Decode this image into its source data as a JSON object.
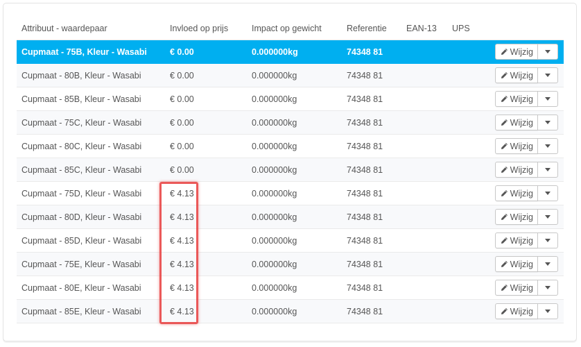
{
  "table": {
    "headers": [
      "Attribuut - waardepaar",
      "Invloed op prijs",
      "Impact op gewicht",
      "Referentie",
      "EAN-13",
      "UPS"
    ],
    "rows": [
      {
        "attributes": "Cupmaat - 75B, Kleur - Wasabi",
        "price_impact": "€ 0.00",
        "weight_impact": "0.000000kg",
        "reference": "74348 81",
        "ean13": "",
        "ups": "",
        "selected": true
      },
      {
        "attributes": "Cupmaat - 80B, Kleur - Wasabi",
        "price_impact": "€ 0.00",
        "weight_impact": "0.000000kg",
        "reference": "74348 81",
        "ean13": "",
        "ups": ""
      },
      {
        "attributes": "Cupmaat - 85B, Kleur - Wasabi",
        "price_impact": "€ 0.00",
        "weight_impact": "0.000000kg",
        "reference": "74348 81",
        "ean13": "",
        "ups": ""
      },
      {
        "attributes": "Cupmaat - 75C, Kleur - Wasabi",
        "price_impact": "€ 0.00",
        "weight_impact": "0.000000kg",
        "reference": "74348 81",
        "ean13": "",
        "ups": ""
      },
      {
        "attributes": "Cupmaat - 80C, Kleur - Wasabi",
        "price_impact": "€ 0.00",
        "weight_impact": "0.000000kg",
        "reference": "74348 81",
        "ean13": "",
        "ups": ""
      },
      {
        "attributes": "Cupmaat - 85C, Kleur - Wasabi",
        "price_impact": "€ 0.00",
        "weight_impact": "0.000000kg",
        "reference": "74348 81",
        "ean13": "",
        "ups": ""
      },
      {
        "attributes": "Cupmaat - 75D, Kleur - Wasabi",
        "price_impact": "€ 4.13",
        "weight_impact": "0.000000kg",
        "reference": "74348 81",
        "ean13": "",
        "ups": ""
      },
      {
        "attributes": "Cupmaat - 80D, Kleur - Wasabi",
        "price_impact": "€ 4.13",
        "weight_impact": "0.000000kg",
        "reference": "74348 81",
        "ean13": "",
        "ups": ""
      },
      {
        "attributes": "Cupmaat - 85D, Kleur - Wasabi",
        "price_impact": "€ 4.13",
        "weight_impact": "0.000000kg",
        "reference": "74348 81",
        "ean13": "",
        "ups": ""
      },
      {
        "attributes": "Cupmaat - 75E, Kleur - Wasabi",
        "price_impact": "€ 4.13",
        "weight_impact": "0.000000kg",
        "reference": "74348 81",
        "ean13": "",
        "ups": ""
      },
      {
        "attributes": "Cupmaat - 80E, Kleur - Wasabi",
        "price_impact": "€ 4.13",
        "weight_impact": "0.000000kg",
        "reference": "74348 81",
        "ean13": "",
        "ups": ""
      },
      {
        "attributes": "Cupmaat - 85E, Kleur - Wasabi",
        "price_impact": "€ 4.13",
        "weight_impact": "0.000000kg",
        "reference": "74348 81",
        "ean13": "",
        "ups": ""
      }
    ],
    "edit_label": "Wijzig",
    "edit_icon": "pencil-icon",
    "dropdown_icon": "caret-down-icon"
  },
  "colors": {
    "selected_row": "#00aff0",
    "annotation": "#e83c3c"
  }
}
